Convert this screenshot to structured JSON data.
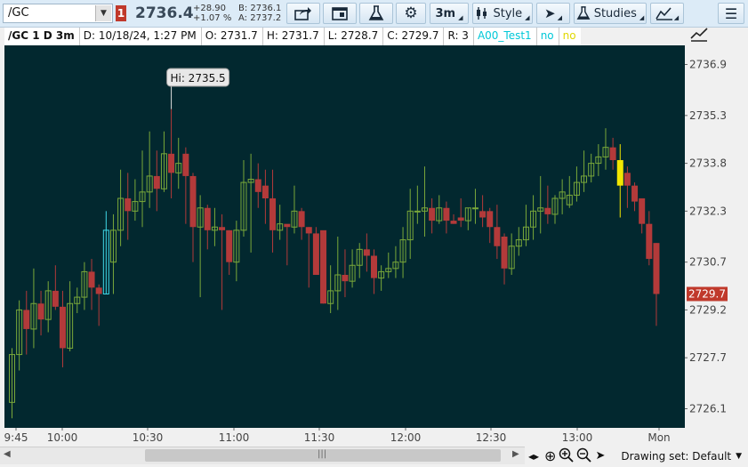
{
  "toolbar": {
    "symbol": "/GC",
    "link_number": "1",
    "last_price": "2736.4",
    "net_change": "+28.90",
    "pct_change": "+1.07 %",
    "bid": "B: 2736.1",
    "ask": "A: 2737.2",
    "timeframe_label": "3m",
    "style_label": "Style",
    "studies_label": "Studies",
    "colors": {
      "up": "#7aa83a",
      "down": "#b33a3a",
      "background": "#02282f",
      "accent": "#c0392b"
    }
  },
  "infobar": {
    "title": "/GC 1 D 3m",
    "date": "D: 10/18/24, 1:27 PM",
    "open": "O: 2731.7",
    "high": "H: 2731.7",
    "low": "L: 2728.7",
    "close": "C: 2729.7",
    "range": "R: 3",
    "study_name": "A00_Test1",
    "study_val1": "no",
    "study_val2": "no"
  },
  "chart_data": {
    "type": "candlestick",
    "xlabel": "",
    "ylabel": "",
    "ylim": [
      2725.5,
      2737.5
    ],
    "y_ticks": [
      "2736.9",
      "2735.3",
      "2733.8",
      "2732.3",
      "2730.7",
      "2729.2",
      "2727.7",
      "2726.1"
    ],
    "x_ticks": [
      "9:45",
      "10:00",
      "10:30",
      "11:00",
      "11:30",
      "12:00",
      "12:30",
      "13:00",
      "Mon"
    ],
    "hi_annotation": "Hi: 2735.5",
    "current_price_label": "2729.7",
    "grid": false,
    "candles": [
      {
        "o": 2726.3,
        "h": 2728.0,
        "l": 2725.8,
        "c": 2727.8
      },
      {
        "o": 2727.8,
        "h": 2729.5,
        "l": 2727.3,
        "c": 2729.2
      },
      {
        "o": 2729.2,
        "h": 2729.8,
        "l": 2727.8,
        "c": 2728.6
      },
      {
        "o": 2728.6,
        "h": 2730.5,
        "l": 2728.0,
        "c": 2729.4
      },
      {
        "o": 2729.4,
        "h": 2729.8,
        "l": 2728.4,
        "c": 2728.9
      },
      {
        "o": 2728.9,
        "h": 2730.1,
        "l": 2728.5,
        "c": 2729.8
      },
      {
        "o": 2729.8,
        "h": 2730.6,
        "l": 2729.2,
        "c": 2729.3
      },
      {
        "o": 2729.3,
        "h": 2729.8,
        "l": 2727.4,
        "c": 2728.0
      },
      {
        "o": 2728.0,
        "h": 2730.1,
        "l": 2727.9,
        "c": 2729.4
      },
      {
        "o": 2729.4,
        "h": 2729.9,
        "l": 2729.1,
        "c": 2729.6
      },
      {
        "o": 2729.6,
        "h": 2730.7,
        "l": 2729.2,
        "c": 2730.4
      },
      {
        "o": 2730.4,
        "h": 2730.8,
        "l": 2729.2,
        "c": 2729.9
      },
      {
        "o": 2729.9,
        "h": 2730.0,
        "l": 2728.7,
        "c": 2729.7
      },
      {
        "o": 2729.7,
        "h": 2732.3,
        "l": 2729.7,
        "c": 2731.7
      },
      {
        "o": 2730.7,
        "h": 2732.2,
        "l": 2729.7,
        "c": 2731.7
      },
      {
        "o": 2731.7,
        "h": 2733.6,
        "l": 2731.2,
        "c": 2732.7
      },
      {
        "o": 2732.7,
        "h": 2733.5,
        "l": 2731.4,
        "c": 2732.3
      },
      {
        "o": 2732.3,
        "h": 2733.3,
        "l": 2732.0,
        "c": 2732.6
      },
      {
        "o": 2732.6,
        "h": 2734.2,
        "l": 2731.8,
        "c": 2732.9
      },
      {
        "o": 2732.9,
        "h": 2734.8,
        "l": 2732.4,
        "c": 2733.4
      },
      {
        "o": 2733.4,
        "h": 2734.2,
        "l": 2732.3,
        "c": 2733.0
      },
      {
        "o": 2733.0,
        "h": 2734.8,
        "l": 2732.9,
        "c": 2734.1
      },
      {
        "o": 2734.1,
        "h": 2735.5,
        "l": 2732.7,
        "c": 2733.5
      },
      {
        "o": 2733.5,
        "h": 2734.6,
        "l": 2733.0,
        "c": 2733.8
      },
      {
        "o": 2734.1,
        "h": 2734.3,
        "l": 2731.9,
        "c": 2733.4
      },
      {
        "o": 2733.4,
        "h": 2733.5,
        "l": 2730.7,
        "c": 2731.8
      },
      {
        "o": 2731.8,
        "h": 2732.8,
        "l": 2729.6,
        "c": 2732.4
      },
      {
        "o": 2732.4,
        "h": 2732.5,
        "l": 2731.1,
        "c": 2731.7
      },
      {
        "o": 2731.7,
        "h": 2732.4,
        "l": 2731.2,
        "c": 2731.8
      },
      {
        "o": 2731.8,
        "h": 2732.2,
        "l": 2729.2,
        "c": 2731.7
      },
      {
        "o": 2731.7,
        "h": 2731.7,
        "l": 2730.3,
        "c": 2730.7
      },
      {
        "o": 2730.7,
        "h": 2732.0,
        "l": 2730.1,
        "c": 2731.7
      },
      {
        "o": 2731.7,
        "h": 2733.9,
        "l": 2731.5,
        "c": 2733.2
      },
      {
        "o": 2733.2,
        "h": 2734.1,
        "l": 2731.0,
        "c": 2733.3
      },
      {
        "o": 2733.3,
        "h": 2733.8,
        "l": 2732.4,
        "c": 2732.9
      },
      {
        "o": 2733.1,
        "h": 2733.6,
        "l": 2731.9,
        "c": 2732.7
      },
      {
        "o": 2732.7,
        "h": 2733.6,
        "l": 2731.0,
        "c": 2731.7
      },
      {
        "o": 2731.7,
        "h": 2732.5,
        "l": 2731.4,
        "c": 2731.9
      },
      {
        "o": 2731.9,
        "h": 2731.8,
        "l": 2730.6,
        "c": 2731.8
      },
      {
        "o": 2731.8,
        "h": 2733.1,
        "l": 2731.6,
        "c": 2732.3
      },
      {
        "o": 2732.3,
        "h": 2732.4,
        "l": 2731.4,
        "c": 2731.8
      },
      {
        "o": 2731.8,
        "h": 2731.8,
        "l": 2729.9,
        "c": 2731.6
      },
      {
        "o": 2731.6,
        "h": 2731.8,
        "l": 2730.4,
        "c": 2730.3
      },
      {
        "o": 2731.7,
        "h": 2731.6,
        "l": 2729.4,
        "c": 2729.4
      },
      {
        "o": 2729.4,
        "h": 2730.6,
        "l": 2729.1,
        "c": 2729.8
      },
      {
        "o": 2729.8,
        "h": 2731.5,
        "l": 2729.2,
        "c": 2730.3
      },
      {
        "o": 2730.3,
        "h": 2731.1,
        "l": 2729.6,
        "c": 2730.1
      },
      {
        "o": 2730.1,
        "h": 2731.1,
        "l": 2729.9,
        "c": 2730.6
      },
      {
        "o": 2730.6,
        "h": 2731.3,
        "l": 2730.2,
        "c": 2731.1
      },
      {
        "o": 2731.1,
        "h": 2731.6,
        "l": 2730.4,
        "c": 2730.9
      },
      {
        "o": 2730.9,
        "h": 2731.1,
        "l": 2729.7,
        "c": 2730.2
      },
      {
        "o": 2730.2,
        "h": 2730.6,
        "l": 2729.8,
        "c": 2730.4
      },
      {
        "o": 2730.4,
        "h": 2731.0,
        "l": 2730.2,
        "c": 2730.5
      },
      {
        "o": 2730.5,
        "h": 2731.2,
        "l": 2730.2,
        "c": 2730.7
      },
      {
        "o": 2730.7,
        "h": 2731.8,
        "l": 2730.2,
        "c": 2731.4
      },
      {
        "o": 2731.4,
        "h": 2733.0,
        "l": 2730.8,
        "c": 2732.3
      },
      {
        "o": 2732.3,
        "h": 2733.1,
        "l": 2731.9,
        "c": 2732.3
      },
      {
        "o": 2732.3,
        "h": 2733.7,
        "l": 2731.5,
        "c": 2732.4
      },
      {
        "o": 2732.4,
        "h": 2732.7,
        "l": 2731.6,
        "c": 2732.0
      },
      {
        "o": 2732.0,
        "h": 2732.8,
        "l": 2731.9,
        "c": 2732.4
      },
      {
        "o": 2732.4,
        "h": 2732.6,
        "l": 2731.6,
        "c": 2732.0
      },
      {
        "o": 2732.0,
        "h": 2732.2,
        "l": 2731.9,
        "c": 2731.9
      },
      {
        "o": 2732.1,
        "h": 2732.7,
        "l": 2731.8,
        "c": 2732.0
      },
      {
        "o": 2732.0,
        "h": 2732.4,
        "l": 2731.7,
        "c": 2732.4
      },
      {
        "o": 2732.4,
        "h": 2733.0,
        "l": 2731.9,
        "c": 2732.4
      },
      {
        "o": 2732.3,
        "h": 2732.8,
        "l": 2731.8,
        "c": 2732.1
      },
      {
        "o": 2732.3,
        "h": 2732.4,
        "l": 2731.3,
        "c": 2731.8
      },
      {
        "o": 2731.8,
        "h": 2732.5,
        "l": 2730.8,
        "c": 2731.2
      },
      {
        "o": 2731.5,
        "h": 2731.6,
        "l": 2730.0,
        "c": 2730.5
      },
      {
        "o": 2730.5,
        "h": 2731.6,
        "l": 2730.3,
        "c": 2731.2
      },
      {
        "o": 2731.2,
        "h": 2731.8,
        "l": 2730.9,
        "c": 2731.4
      },
      {
        "o": 2731.4,
        "h": 2732.5,
        "l": 2731.2,
        "c": 2731.8
      },
      {
        "o": 2731.8,
        "h": 2732.8,
        "l": 2731.4,
        "c": 2732.3
      },
      {
        "o": 2732.3,
        "h": 2733.4,
        "l": 2731.6,
        "c": 2732.4
      },
      {
        "o": 2732.4,
        "h": 2733.1,
        "l": 2731.9,
        "c": 2732.2
      },
      {
        "o": 2732.2,
        "h": 2732.8,
        "l": 2731.9,
        "c": 2732.7
      },
      {
        "o": 2732.7,
        "h": 2733.3,
        "l": 2732.2,
        "c": 2732.9
      },
      {
        "o": 2732.5,
        "h": 2733.4,
        "l": 2732.4,
        "c": 2732.8
      },
      {
        "o": 2732.8,
        "h": 2733.7,
        "l": 2732.6,
        "c": 2733.2
      },
      {
        "o": 2733.2,
        "h": 2734.2,
        "l": 2732.9,
        "c": 2733.4
      },
      {
        "o": 2733.4,
        "h": 2734.1,
        "l": 2733.2,
        "c": 2733.8
      },
      {
        "o": 2733.8,
        "h": 2734.4,
        "l": 2733.4,
        "c": 2734.0
      },
      {
        "o": 2734.0,
        "h": 2734.9,
        "l": 2733.6,
        "c": 2734.3
      },
      {
        "o": 2734.3,
        "h": 2734.6,
        "l": 2733.6,
        "c": 2733.9
      },
      {
        "o": 2733.9,
        "h": 2734.4,
        "l": 2732.1,
        "c": 2733.1
      },
      {
        "o": 2733.5,
        "h": 2733.7,
        "l": 2732.4,
        "c": 2733.1
      },
      {
        "o": 2733.1,
        "h": 2733.2,
        "l": 2732.3,
        "c": 2732.6
      },
      {
        "o": 2732.7,
        "h": 2732.7,
        "l": 2731.6,
        "c": 2731.9
      },
      {
        "o": 2731.9,
        "h": 2732.3,
        "l": 2730.6,
        "c": 2730.8
      },
      {
        "o": 2731.3,
        "h": 2731.3,
        "l": 2728.7,
        "c": 2729.7
      }
    ]
  },
  "bottom": {
    "drawing_set": "Drawing set: Default",
    "scroll_grip": "|||"
  }
}
